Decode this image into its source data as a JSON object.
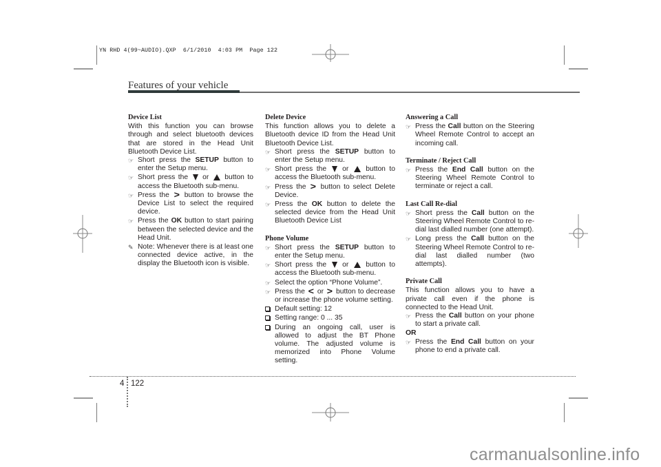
{
  "slug_line": "YN RHD 4(99~AUDIO).QXP  6/1/2010  4:03 PM  Page 122",
  "header": {
    "title": "Features of your vehicle"
  },
  "footer": {
    "chapter": "4",
    "page": "122"
  },
  "watermark": "carmanualsonline.info",
  "icons": {
    "bullet": "pointing-hand-icon",
    "note": "pencil-note-icon",
    "checkbox": "checkbox-icon",
    "down": "down-triangle-icon",
    "up": "up-triangle-icon",
    "right": "right-chevron-icon",
    "left": "left-chevron-icon"
  },
  "col1": {
    "device_list": {
      "heading": "Device List",
      "intro": "With this function you can browse through and select bluetooth devices that are stored in the Head Unit Bluetooth Device List.",
      "s1_pre": "Short press the ",
      "s1_bold": "SETUP",
      "s1_post": " button to enter the Setup menu.",
      "s2_pre": "Short press the ",
      "s2_mid": " or ",
      "s2_post": " button to access the Bluetooth sub-menu.",
      "s3_pre": "Press the ",
      "s3_post": " button to browse the Device List to select the required device.",
      "s4_pre": "Press the ",
      "s4_bold": "OK",
      "s4_post": " button to start pairing between the selected device and the Head Unit.",
      "note": "Note: Whenever there is at least one connected device active, in the display the Bluetooth icon is visible."
    }
  },
  "col2": {
    "delete_device": {
      "heading": "Delete Device",
      "intro": "This function allows you to delete a Bluetooth device ID from the Head Unit Bluetooth Device List.",
      "s1_pre": "Short press the ",
      "s1_bold": "SETUP",
      "s1_post": " button to enter the Setup menu.",
      "s2_pre": "Short press the ",
      "s2_mid": " or ",
      "s2_post": " button to access the Bluetooth sub-menu.",
      "s3_pre": "Press the ",
      "s3_post": " button to select Delete Device.",
      "s4_pre": "Press the ",
      "s4_bold": "OK",
      "s4_post": " button to delete the selected device from the Head Unit Bluetooth Device List"
    },
    "phone_volume": {
      "heading": "Phone Volume",
      "s1_pre": "Short press the ",
      "s1_bold": "SETUP",
      "s1_post": " button to enter the Setup menu.",
      "s2_pre": "Short press the ",
      "s2_mid": " or ",
      "s2_post": " button to access the Bluetooth sub-menu.",
      "s3": "Select the option “Phone Volume”.",
      "s4_pre": "Press the ",
      "s4_mid": " or ",
      "s4_post": " button to decrease or increase the phone volume setting.",
      "c1": "Default setting: 12",
      "c2": "Setting range: 0 ... 35",
      "c3": "During an ongoing call, user is allowed to adjust the BT Phone volume. The adjusted volume is memorized into Phone Volume setting."
    }
  },
  "col3": {
    "answering": {
      "heading": "Answering a Call",
      "s1_pre": "Press the ",
      "s1_bold": "Call",
      "s1_post": " button on the Steering Wheel Remote Control to accept an incoming call."
    },
    "terminate": {
      "heading": "Terminate / Reject Call",
      "s1_pre": "Press the ",
      "s1_bold": "End Call",
      "s1_post": " button on the Steering Wheel Remote Control to terminate or reject a call."
    },
    "redial": {
      "heading": "Last Call Re-dial",
      "s1_pre": "Short press the ",
      "s1_bold": "Call",
      "s1_post": " button on the Steering Wheel Remote Control to re-dial last dialled number (one attempt).",
      "s2_pre": "Long press the ",
      "s2_bold": "Call",
      "s2_post": " button on the Steering Wheel Remote Control to re-dial last dialled number (two attempts)."
    },
    "private": {
      "heading": "Private Call",
      "intro": "This function allows you to have a private call even if the phone is connected to the Head Unit.",
      "s1_pre": "Press the ",
      "s1_bold": "Call",
      "s1_post": " button on your phone to start a private call.",
      "or": "OR",
      "s2_pre": "Press the ",
      "s2_bold": "End Call",
      "s2_post": " button on your phone to end a private call."
    }
  }
}
